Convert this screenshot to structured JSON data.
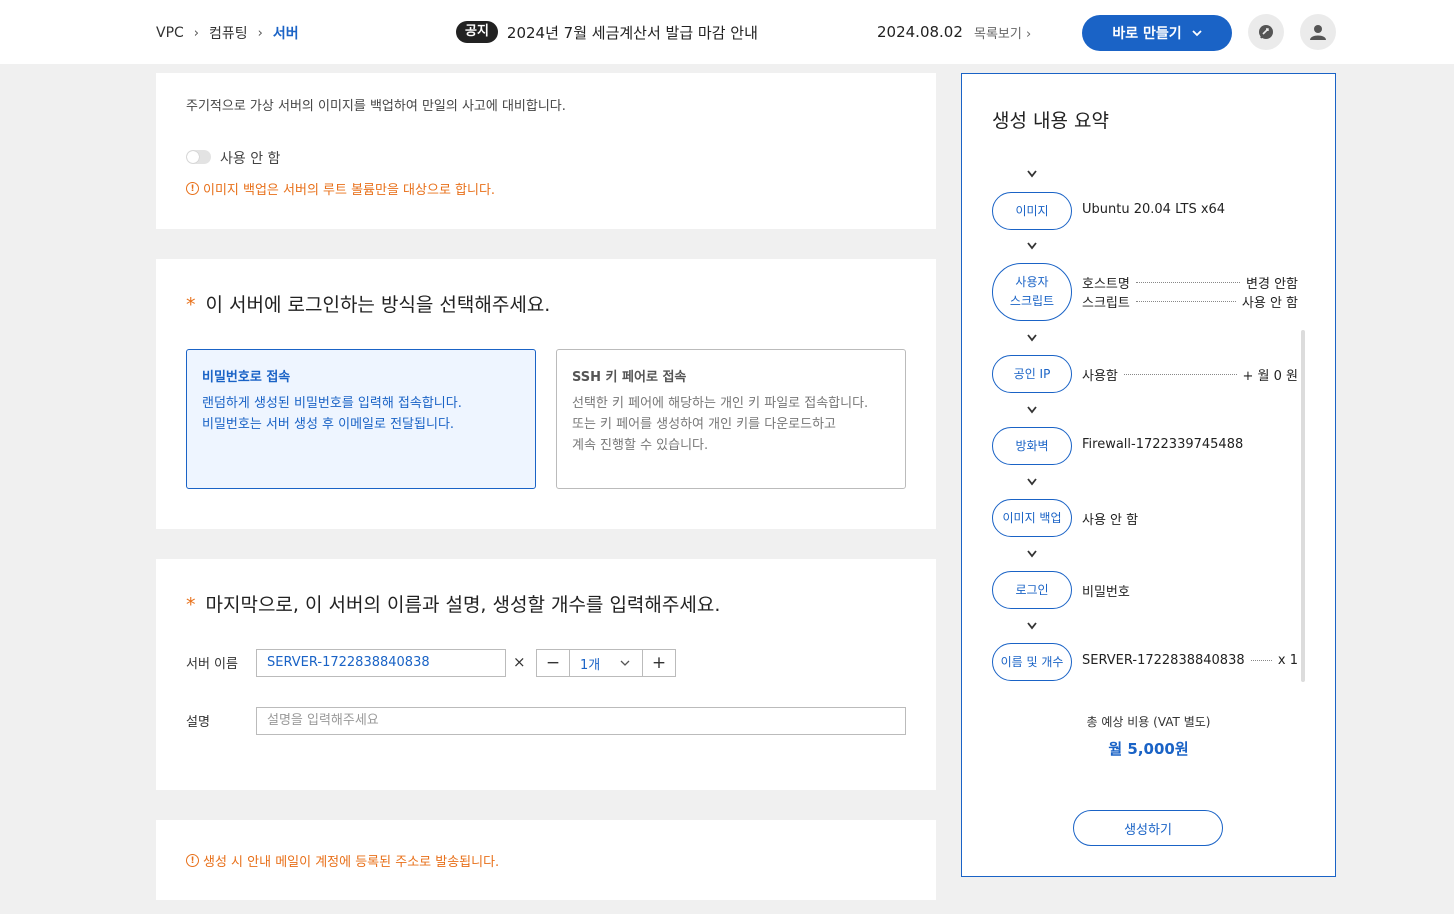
{
  "header": {
    "breadcrumb": [
      "VPC",
      "컴퓨팅",
      "서버"
    ],
    "notice_badge": "공지",
    "notice_text": "2024년 7월 세금계산서 발급 마감 안내",
    "notice_date": "2024.08.02",
    "notice_list_label": "목록보기",
    "create_button": "바로 만들기"
  },
  "backup": {
    "description": "주기적으로 가상 서버의 이미지를 백업하여 만일의 사고에 대비합니다.",
    "toggle_label": "사용 안 함",
    "warning": "이미지 백업은 서버의 루트 볼륨만을 대상으로 합니다."
  },
  "login": {
    "title": "이 서버에 로그인하는 방식을 선택해주세요.",
    "options": [
      {
        "title": "비밀번호로 접속",
        "lines": [
          "랜덤하게 생성된 비밀번호를 입력해 접속합니다.",
          "비밀번호는 서버 생성 후 이메일로 전달됩니다."
        ],
        "selected": true
      },
      {
        "title": "SSH 키 페어로 접속",
        "lines": [
          "선택한 키 페어에 해당하는 개인 키 파일로 접속합니다.",
          "또는 키 페어를 생성하여 개인 키를 다운로드하고",
          "계속 진행할 수 있습니다."
        ],
        "selected": false
      }
    ]
  },
  "name": {
    "title": "마지막으로, 이 서버의 이름과 설명, 생성할 개수를 입력해주세요.",
    "server_name_label": "서버 이름",
    "server_name_value": "SERVER-1722838840838",
    "times": "×",
    "count": "1개",
    "minus": "−",
    "plus": "+",
    "desc_label": "설명",
    "desc_placeholder": "설명을 입력해주세요"
  },
  "mail_warning": "생성 시 안내 메일이 계정에 등록된 주소로 발송됩니다.",
  "summary": {
    "title": "생성 내용 요약",
    "image_label": "이미지",
    "image_value": "Ubuntu 20.04 LTS x64",
    "user_script_label": [
      "사용자",
      "스크립트"
    ],
    "hostname_key": "호스트명",
    "hostname_value": "변경 안함",
    "script_key": "스크립트",
    "script_value": "사용 안 함",
    "public_ip_label": "공인 IP",
    "public_ip_value": "사용함",
    "public_ip_price": "+ 월 0 원",
    "firewall_label": "방화벽",
    "firewall_value": "Firewall-1722339745488",
    "backup_label": "이미지 백업",
    "backup_value": "사용 안 함",
    "login_label": "로그인",
    "login_value": "비밀번호",
    "name_label": "이름 및 개수",
    "name_value": "SERVER-1722838840838",
    "name_count": "x 1",
    "total_label": "총 예상 비용 (VAT 별도)",
    "total_value": "월 5,000원",
    "submit": "생성하기"
  },
  "colors": {
    "accent": "#1a63c6",
    "warning": "#e8701a"
  }
}
